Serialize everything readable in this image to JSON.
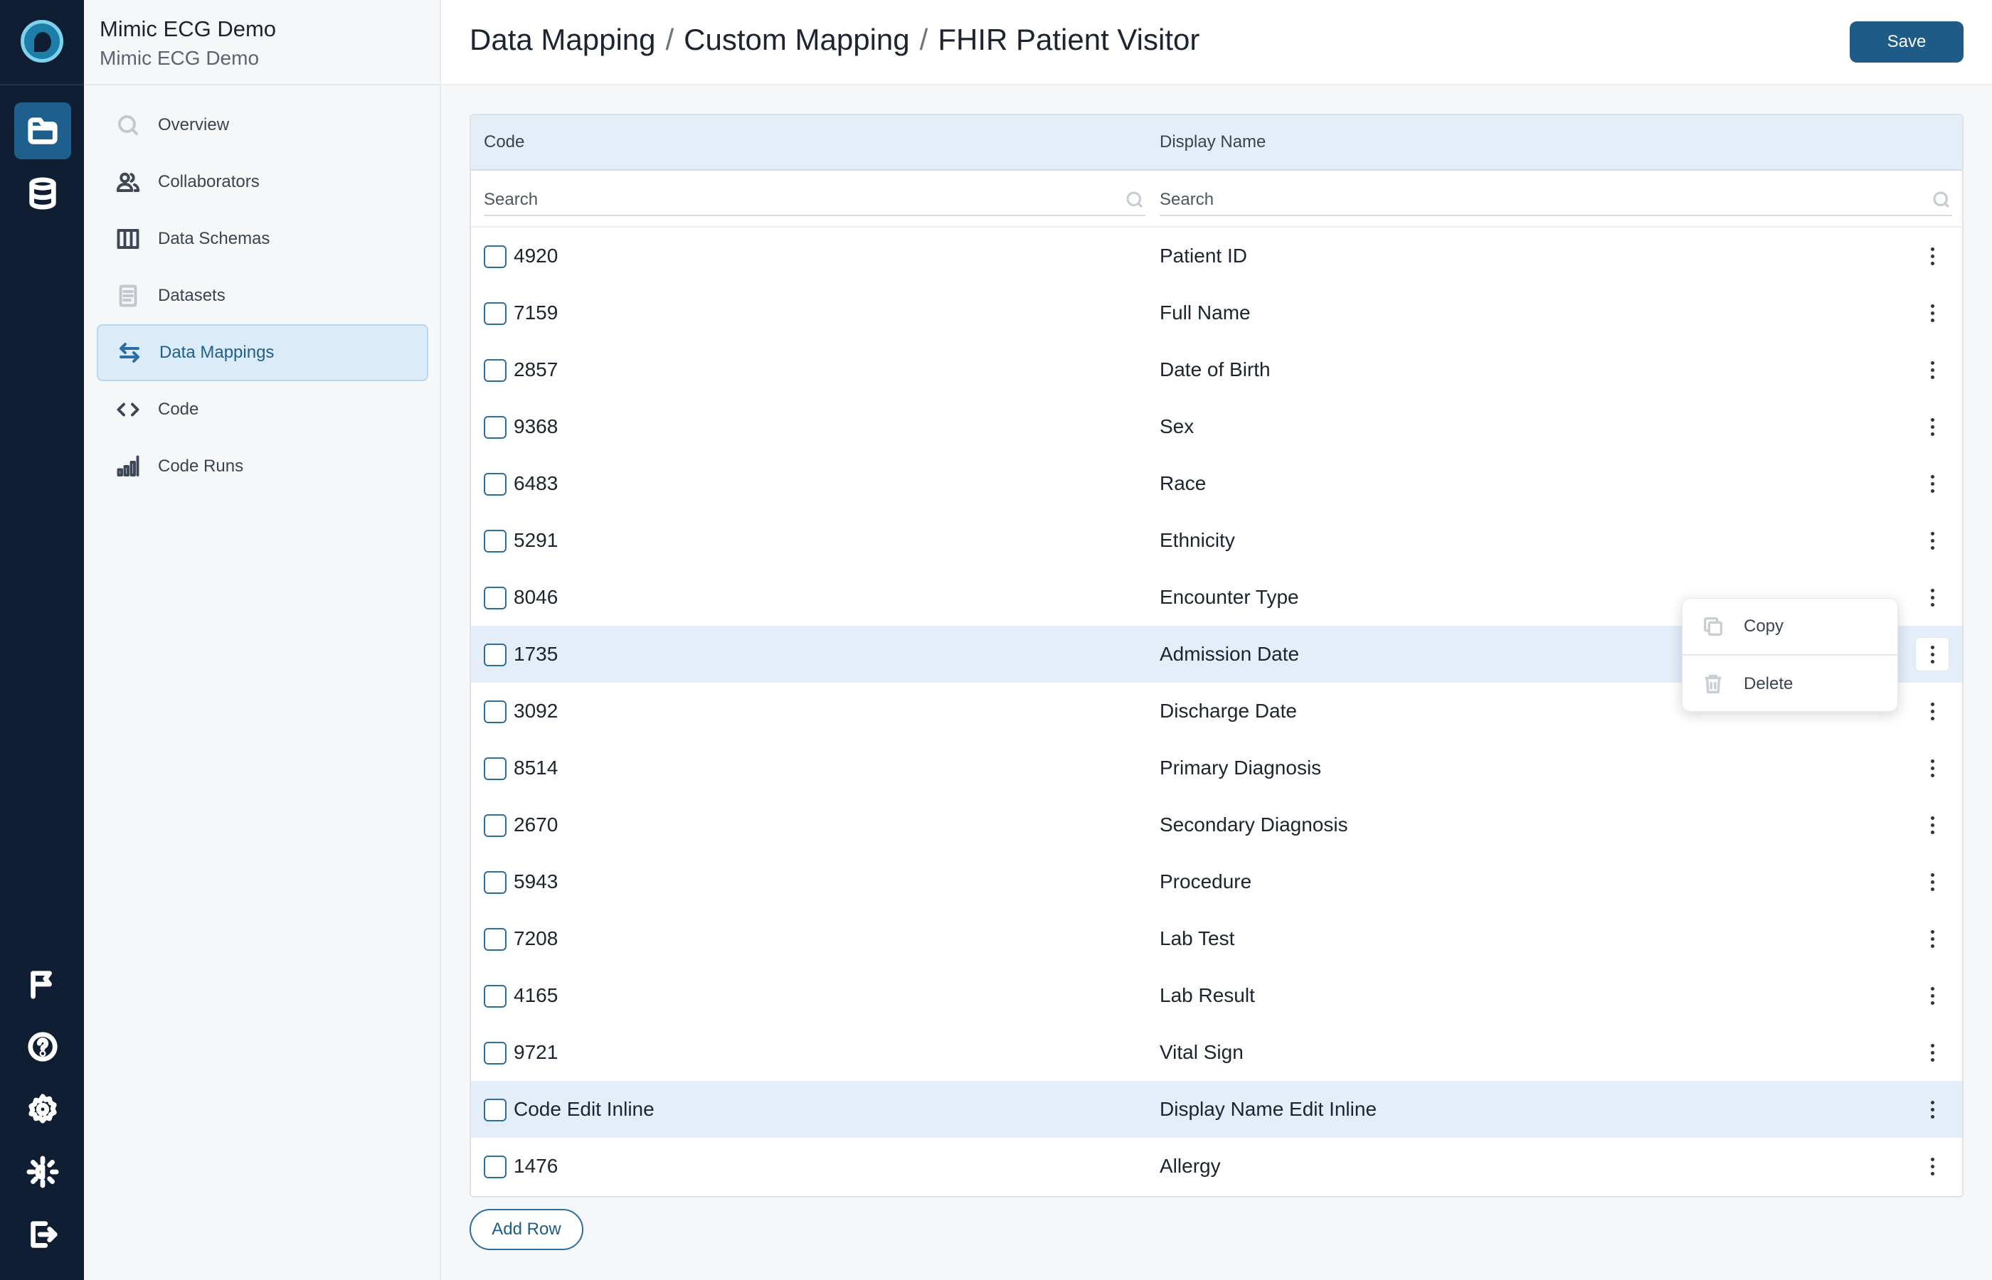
{
  "project": {
    "title": "Mimic ECG Demo",
    "subtitle": "Mimic ECG Demo"
  },
  "rail": {
    "top_icons": [
      "folder-icon",
      "database-icon"
    ],
    "bottom_icons": [
      "flag-icon",
      "help-icon",
      "settings-icon",
      "theme-toggle-icon",
      "logout-icon"
    ]
  },
  "sidebar": {
    "items": [
      {
        "label": "Overview",
        "icon": "search-icon"
      },
      {
        "label": "Collaborators",
        "icon": "users-icon"
      },
      {
        "label": "Data Schemas",
        "icon": "columns-icon"
      },
      {
        "label": "Datasets",
        "icon": "document-icon"
      },
      {
        "label": "Data Mappings",
        "icon": "arrows-exchange-icon",
        "active": true
      },
      {
        "label": "Code",
        "icon": "code-icon"
      },
      {
        "label": "Code Runs",
        "icon": "bar-chart-icon"
      }
    ]
  },
  "header": {
    "crumbs": [
      "Data Mapping",
      "Custom Mapping",
      "FHIR Patient Visitor"
    ],
    "separator": "/",
    "save_label": "Save"
  },
  "table": {
    "columns": {
      "code": "Code",
      "display": "Display Name"
    },
    "filters": {
      "code_placeholder": "Search",
      "display_placeholder": "Search"
    },
    "rows": [
      {
        "code": "4920",
        "display": "Patient ID"
      },
      {
        "code": "7159",
        "display": "Full Name"
      },
      {
        "code": "2857",
        "display": "Date of Birth"
      },
      {
        "code": "9368",
        "display": "Sex"
      },
      {
        "code": "6483",
        "display": "Race"
      },
      {
        "code": "5291",
        "display": "Ethnicity"
      },
      {
        "code": "8046",
        "display": "Encounter Type"
      },
      {
        "code": "1735",
        "display": "Admission Date"
      },
      {
        "code": "3092",
        "display": "Discharge Date"
      },
      {
        "code": "8514",
        "display": "Primary Diagnosis"
      },
      {
        "code": "2670",
        "display": "Secondary Diagnosis"
      },
      {
        "code": "5943",
        "display": "Procedure"
      },
      {
        "code": "7208",
        "display": "Lab Test"
      },
      {
        "code": "4165",
        "display": "Lab Result"
      },
      {
        "code": "9721",
        "display": "Vital Sign"
      },
      {
        "code": "Code Edit Inline",
        "display": "Display Name Edit Inline"
      },
      {
        "code": "1476",
        "display": "Allergy"
      }
    ],
    "add_row_label": "Add Row"
  },
  "context_menu": {
    "items": [
      {
        "label": "Copy",
        "icon": "copy-icon"
      },
      {
        "label": "Delete",
        "icon": "trash-icon"
      }
    ]
  }
}
